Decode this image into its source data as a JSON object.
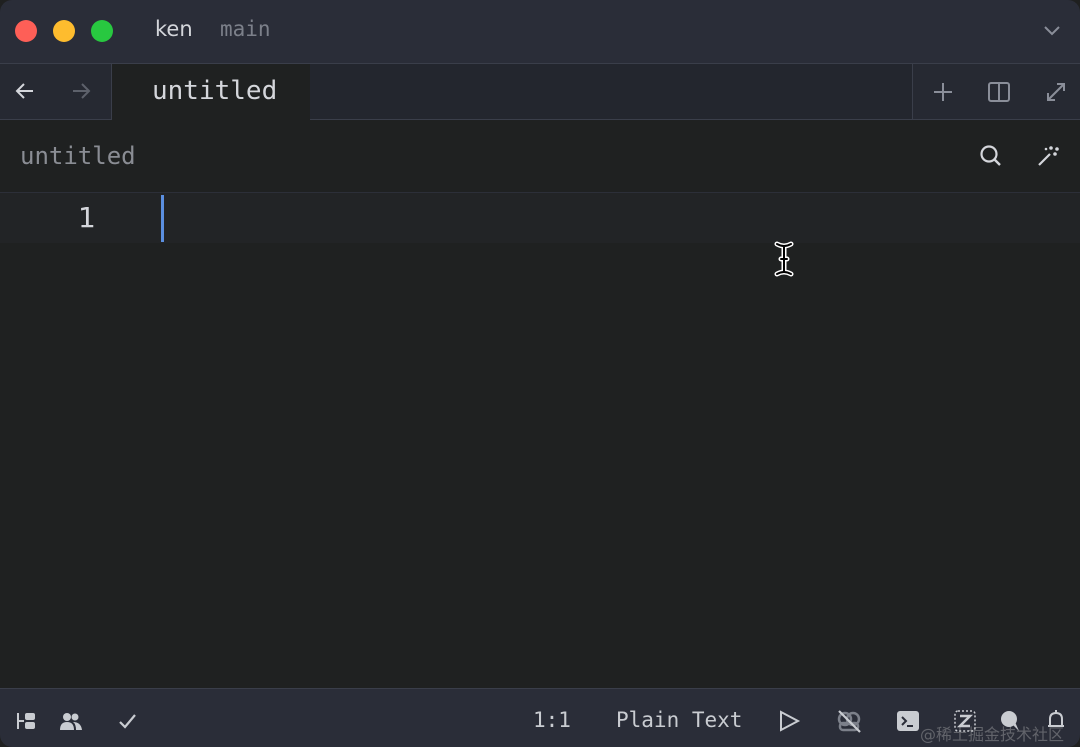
{
  "titlebar": {
    "project": "ken",
    "branch": "main",
    "traffic_lights": {
      "close": "#fe5f57",
      "minimize": "#febc2e",
      "zoom": "#28c840"
    },
    "menu_icon": "chevron-down-icon"
  },
  "tabbar": {
    "back_icon": "arrow-left-icon",
    "forward_icon": "arrow-right-icon",
    "tabs": [
      {
        "label": "untitled",
        "active": true
      }
    ],
    "actions": [
      {
        "name": "new-tab",
        "icon": "plus-icon"
      },
      {
        "name": "split-pane",
        "icon": "split-icon"
      },
      {
        "name": "zoom-pane",
        "icon": "maximize-icon"
      }
    ]
  },
  "toolbar": {
    "breadcrumb": "untitled",
    "search_icon": "search-icon",
    "assistant_icon": "magic-wand-icon"
  },
  "editor": {
    "lines": [
      {
        "number": "1",
        "text": ""
      }
    ],
    "caret_color": "#5b8fe0"
  },
  "statusbar": {
    "left_icons": [
      "project-panel-icon",
      "collab-icon",
      "diagnostics-check-icon"
    ],
    "cursor_position": "1:1",
    "language": "Plain Text",
    "right_icons": [
      "run-icon",
      "copilot-disabled-icon",
      "terminal-icon",
      "zed-icon",
      "chat-icon",
      "bell-icon"
    ],
    "watermark": "@稀土掘金技术社区"
  }
}
